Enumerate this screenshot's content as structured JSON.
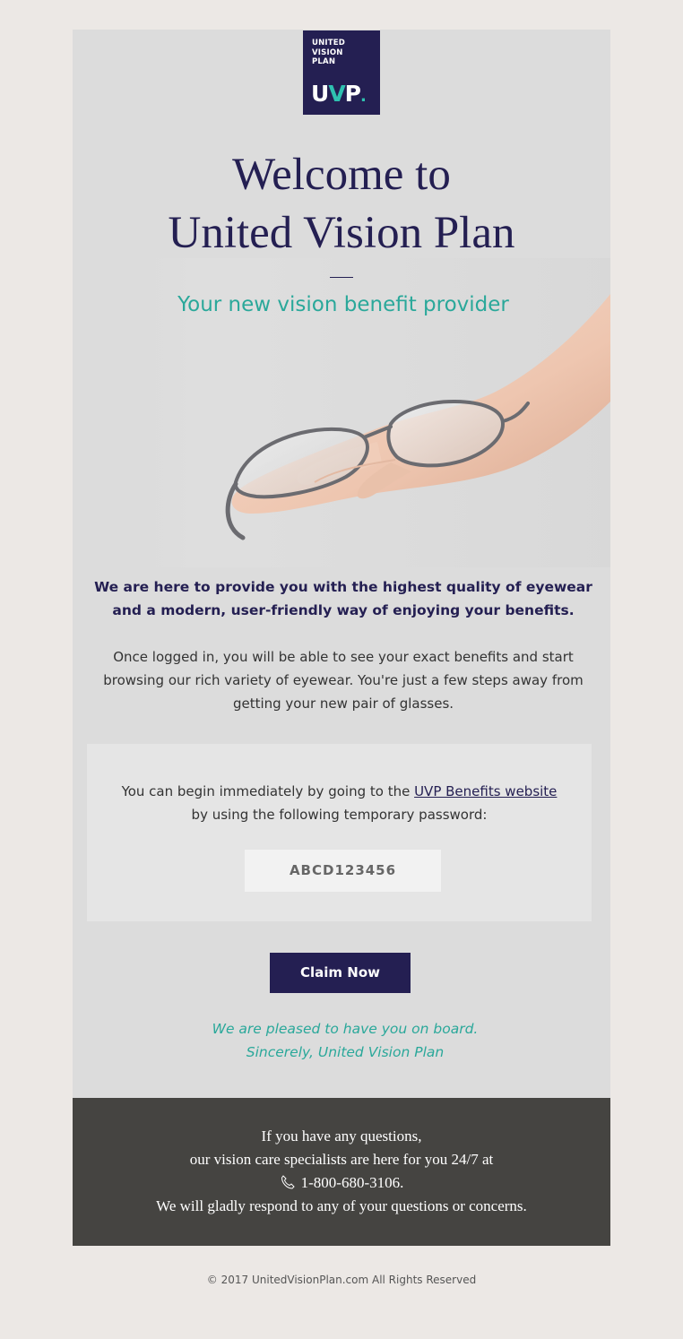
{
  "brand": {
    "logo_text": "UNITED\nVISION\nPLAN",
    "logo_mark_u": "U",
    "logo_mark_v": "V",
    "logo_mark_p": "P",
    "logo_mark_dot": ".",
    "navy": "#241f52",
    "teal": "#2aa89a"
  },
  "header": {
    "title_line1": "Welcome to",
    "title_line2": "United Vision Plan",
    "subtitle": "Your new vision benefit provider"
  },
  "hero": {
    "icon": "hand-holding-glasses-illustration"
  },
  "intro": {
    "lead": "We are here to provide you with the highest quality of eyewear and a modern, user-friendly way of enjoying your benefits.",
    "body": "Once logged in, you will be able to see your exact benefits and start browsing our rich variety of eyewear. You're just a few steps away from getting your new pair of glasses."
  },
  "panel": {
    "text_before_link": "You can begin immediately by going to the ",
    "link_text": "UVP Benefits website",
    "text_after_link": "by using the following temporary password:",
    "password": "ABCD123456"
  },
  "cta": {
    "label": "Claim Now"
  },
  "signoff": {
    "line1": "We are pleased to have you on board.",
    "line2": "Sincerely, United Vision Plan"
  },
  "footer": {
    "line1": "If you have any questions,",
    "line2": "our vision care specialists are here for you 24/7 at",
    "phone": "1-800-680-3106.",
    "phone_icon": "phone-icon",
    "line4": "We will gladly respond to any of your questions or concerns."
  },
  "copyright": "© 2017 UnitedVisionPlan.com All Rights Reserved"
}
